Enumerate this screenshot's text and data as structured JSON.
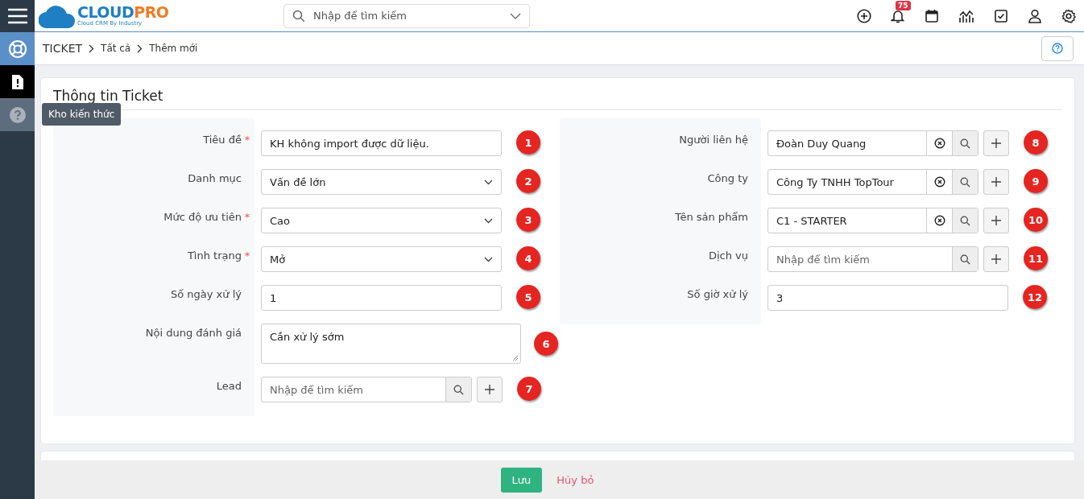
{
  "header": {
    "logo": {
      "text_1": "CLOUD",
      "text_2": "PRO",
      "tagline": "Cloud CRM By Industry"
    },
    "search": {
      "placeholder": "Nhập để tìm kiếm"
    },
    "notification_count": "75"
  },
  "sidebar": {
    "items": [
      {
        "kind": "lifebuoy",
        "color": "#5b8fc7"
      },
      {
        "kind": "ticket",
        "color": "#000000"
      },
      {
        "kind": "help",
        "color": "#5d6d7e",
        "tooltip": "Kho kiến thức"
      }
    ]
  },
  "breadcrumb": [
    "TICKET",
    "Tất cả",
    "Thêm mới"
  ],
  "card": {
    "title": "Thông tin Ticket",
    "left_fields": [
      {
        "kind": "text",
        "label": "Tiêu đề",
        "required_mark": "*",
        "value": "KH không import được dữ liệu.",
        "badge": "1"
      },
      {
        "kind": "select",
        "label": "Danh mục",
        "value": "Vấn đề lớn",
        "badge": "2"
      },
      {
        "kind": "select",
        "label": "Mức độ ưu tiên",
        "required_mark": "*",
        "value": "Cao",
        "badge": "3"
      },
      {
        "kind": "select",
        "label": "Tình trạng",
        "required_mark": "*",
        "value": "Mở",
        "badge": "4"
      },
      {
        "kind": "text",
        "label": "Số ngày xử lý",
        "value": "1",
        "badge": "5"
      },
      {
        "kind": "textarea",
        "label": "Nội dung đánh giá",
        "value": "Cần xử lý sớm",
        "badge": "6"
      },
      {
        "kind": "lookup",
        "label": "Lead",
        "placeholder": "Nhập để tìm kiếm",
        "badge": "7"
      }
    ],
    "right_fields": [
      {
        "kind": "lookup",
        "label": "Người liên hệ",
        "value": "Đoàn Duy Quang",
        "badge": "8"
      },
      {
        "kind": "lookup",
        "label": "Công ty",
        "value": "Công Ty TNHH TopTour",
        "badge": "9"
      },
      {
        "kind": "lookup",
        "label": "Tên sản phẩm",
        "value": "C1 - STARTER",
        "badge": "10"
      },
      {
        "kind": "lookup",
        "label": "Dịch vụ",
        "placeholder": "Nhập để tìm kiếm",
        "badge": "11"
      },
      {
        "kind": "text",
        "label": "Số giờ xử lý",
        "value": "3",
        "badge": "12"
      }
    ]
  },
  "footer": {
    "save": "Lưu",
    "cancel": "Hủy bỏ"
  }
}
